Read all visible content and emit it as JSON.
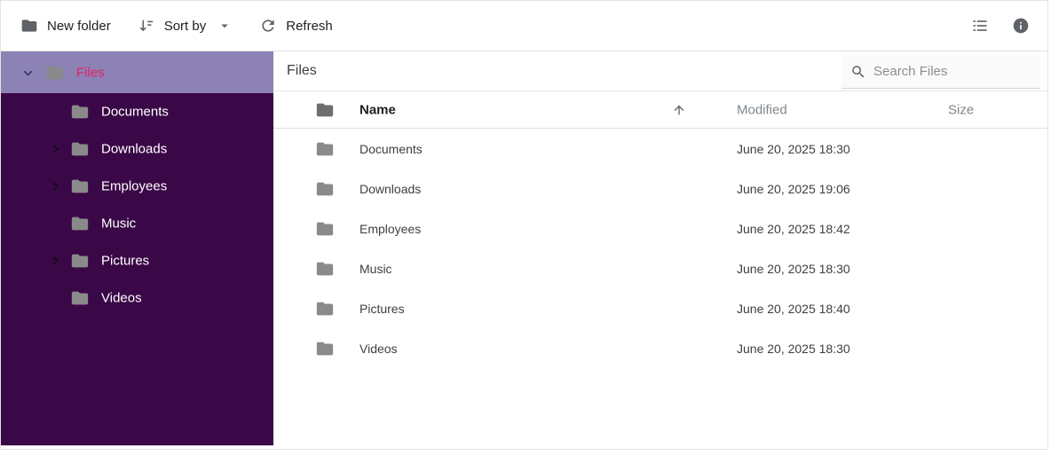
{
  "toolbar": {
    "new_folder_label": "New folder",
    "sort_by_label": "Sort by",
    "refresh_label": "Refresh"
  },
  "sidebar": {
    "root": {
      "label": "Files",
      "selected": true,
      "expanded": true
    },
    "items": [
      {
        "label": "Documents",
        "expandable": false
      },
      {
        "label": "Downloads",
        "expandable": true
      },
      {
        "label": "Employees",
        "expandable": true
      },
      {
        "label": "Music",
        "expandable": false
      },
      {
        "label": "Pictures",
        "expandable": true
      },
      {
        "label": "Videos",
        "expandable": false
      }
    ]
  },
  "main": {
    "title": "Files",
    "search": {
      "placeholder": "Search Files",
      "value": ""
    },
    "table": {
      "columns": {
        "name": "Name",
        "modified": "Modified",
        "size": "Size"
      },
      "sort": {
        "column": "Name",
        "direction": "ascending"
      },
      "rows": [
        {
          "name": "Documents",
          "modified": "June 20, 2025 18:30",
          "size": ""
        },
        {
          "name": "Downloads",
          "modified": "June 20, 2025 19:06",
          "size": ""
        },
        {
          "name": "Employees",
          "modified": "June 20, 2025 18:42",
          "size": ""
        },
        {
          "name": "Music",
          "modified": "June 20, 2025 18:30",
          "size": ""
        },
        {
          "name": "Pictures",
          "modified": "June 20, 2025 18:40",
          "size": ""
        },
        {
          "name": "Videos",
          "modified": "June 20, 2025 18:30",
          "size": ""
        }
      ]
    }
  },
  "icons": {
    "toolbar": [
      "folder-icon",
      "sort-descending-icon",
      "caret-down-icon",
      "refresh-icon",
      "list-view-icon",
      "info-icon"
    ],
    "search": "search-icon",
    "tree": [
      "chevron-down-icon",
      "chevron-right-icon",
      "folder-icon"
    ],
    "table_sort": "arrow-up-icon"
  },
  "colors": {
    "sidebar_bg": "#3a0747",
    "sidebar_selected_bg": "#8c82b6",
    "selected_label": "#e91e63",
    "folder_icon_gray": "#8a8a8a",
    "toolbar_icon_gray": "#5f6368",
    "muted_text": "#80868b",
    "border": "#e0e0e0"
  }
}
